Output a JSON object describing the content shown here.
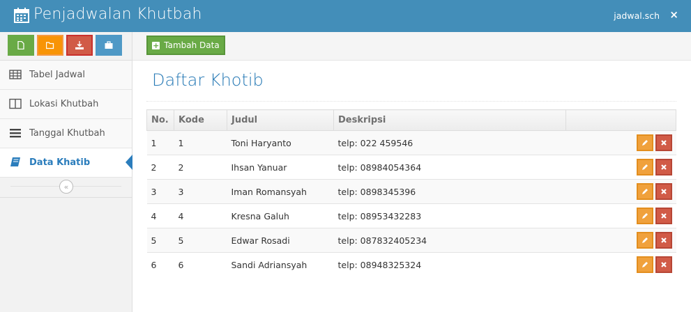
{
  "app": {
    "title": "Penjadwalan Khutbah",
    "user": "jadwal.sch",
    "close_glyph": "×"
  },
  "shortcuts": [
    {
      "name": "new-file",
      "color": "#69aa46"
    },
    {
      "name": "open-folder",
      "color": "#f89406"
    },
    {
      "name": "download",
      "color": "#d15b47"
    },
    {
      "name": "briefcase",
      "color": "#4f99c6"
    }
  ],
  "sidebar": {
    "items": [
      {
        "label": "Tabel Jadwal",
        "icon": "table-icon"
      },
      {
        "label": "Lokasi Khutbah",
        "icon": "columns-icon"
      },
      {
        "label": "Tanggal Khutbah",
        "icon": "list-icon"
      },
      {
        "label": "Data Khatib",
        "icon": "book-icon",
        "active": true
      }
    ],
    "collapse_glyph": "«"
  },
  "toolbar": {
    "add_label": "Tambah Data",
    "add_glyph": "+"
  },
  "main": {
    "title": "Daftar Khotib",
    "table": {
      "headers": [
        "No.",
        "Kode",
        "Judul",
        "Deskripsi"
      ],
      "rows": [
        [
          "1",
          "1",
          "Toni Haryanto",
          "telp: 022 459546"
        ],
        [
          "2",
          "2",
          "Ihsan Yanuar",
          "telp: 08984054364"
        ],
        [
          "3",
          "3",
          "Iman Romansyah",
          "telp: 0898345396"
        ],
        [
          "4",
          "4",
          "Kresna Galuh",
          "telp: 08953432283"
        ],
        [
          "5",
          "5",
          "Edwar Rosadi",
          "telp: 087832405234"
        ],
        [
          "6",
          "6",
          "Sandi Adriansyah",
          "telp: 08948325324"
        ]
      ]
    }
  },
  "colors": {
    "header": "#438eb9",
    "accent": "#2b7dbc",
    "edit": "#f0a13c",
    "delete": "#d15b47"
  }
}
